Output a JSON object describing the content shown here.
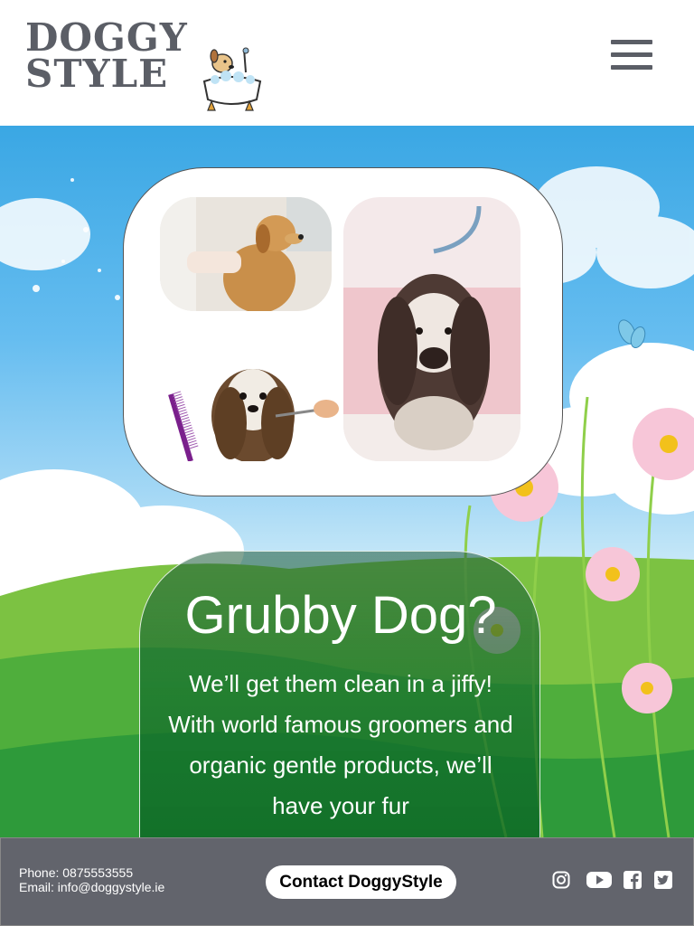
{
  "header": {
    "logo_line1": "DOGGY",
    "logo_line2": "STYLE",
    "menu_icon": "hamburger-menu-icon"
  },
  "hero": {
    "photos": [
      "golden-retriever-grooming",
      "spaniel-wet-portrait",
      "shih-tzu-haircut"
    ],
    "card": {
      "title": "Grubby Dog?",
      "body": "We’ll get them clean in a jiffy! With world famous groomers and organic gentle products, we’ll have your fur"
    }
  },
  "footer": {
    "phone": "Phone: 0875553555",
    "email": "Email: info@doggystyle.ie",
    "contact_button": "Contact DoggyStyle",
    "social_icons": [
      "instagram-icon",
      "youtube-icon",
      "facebook-icon",
      "twitter-icon"
    ]
  },
  "colors": {
    "brand_gray": "#5b5e66",
    "footer_bg": "#62646c",
    "sky": "#3aa7e4",
    "grass": "#2ea043"
  }
}
